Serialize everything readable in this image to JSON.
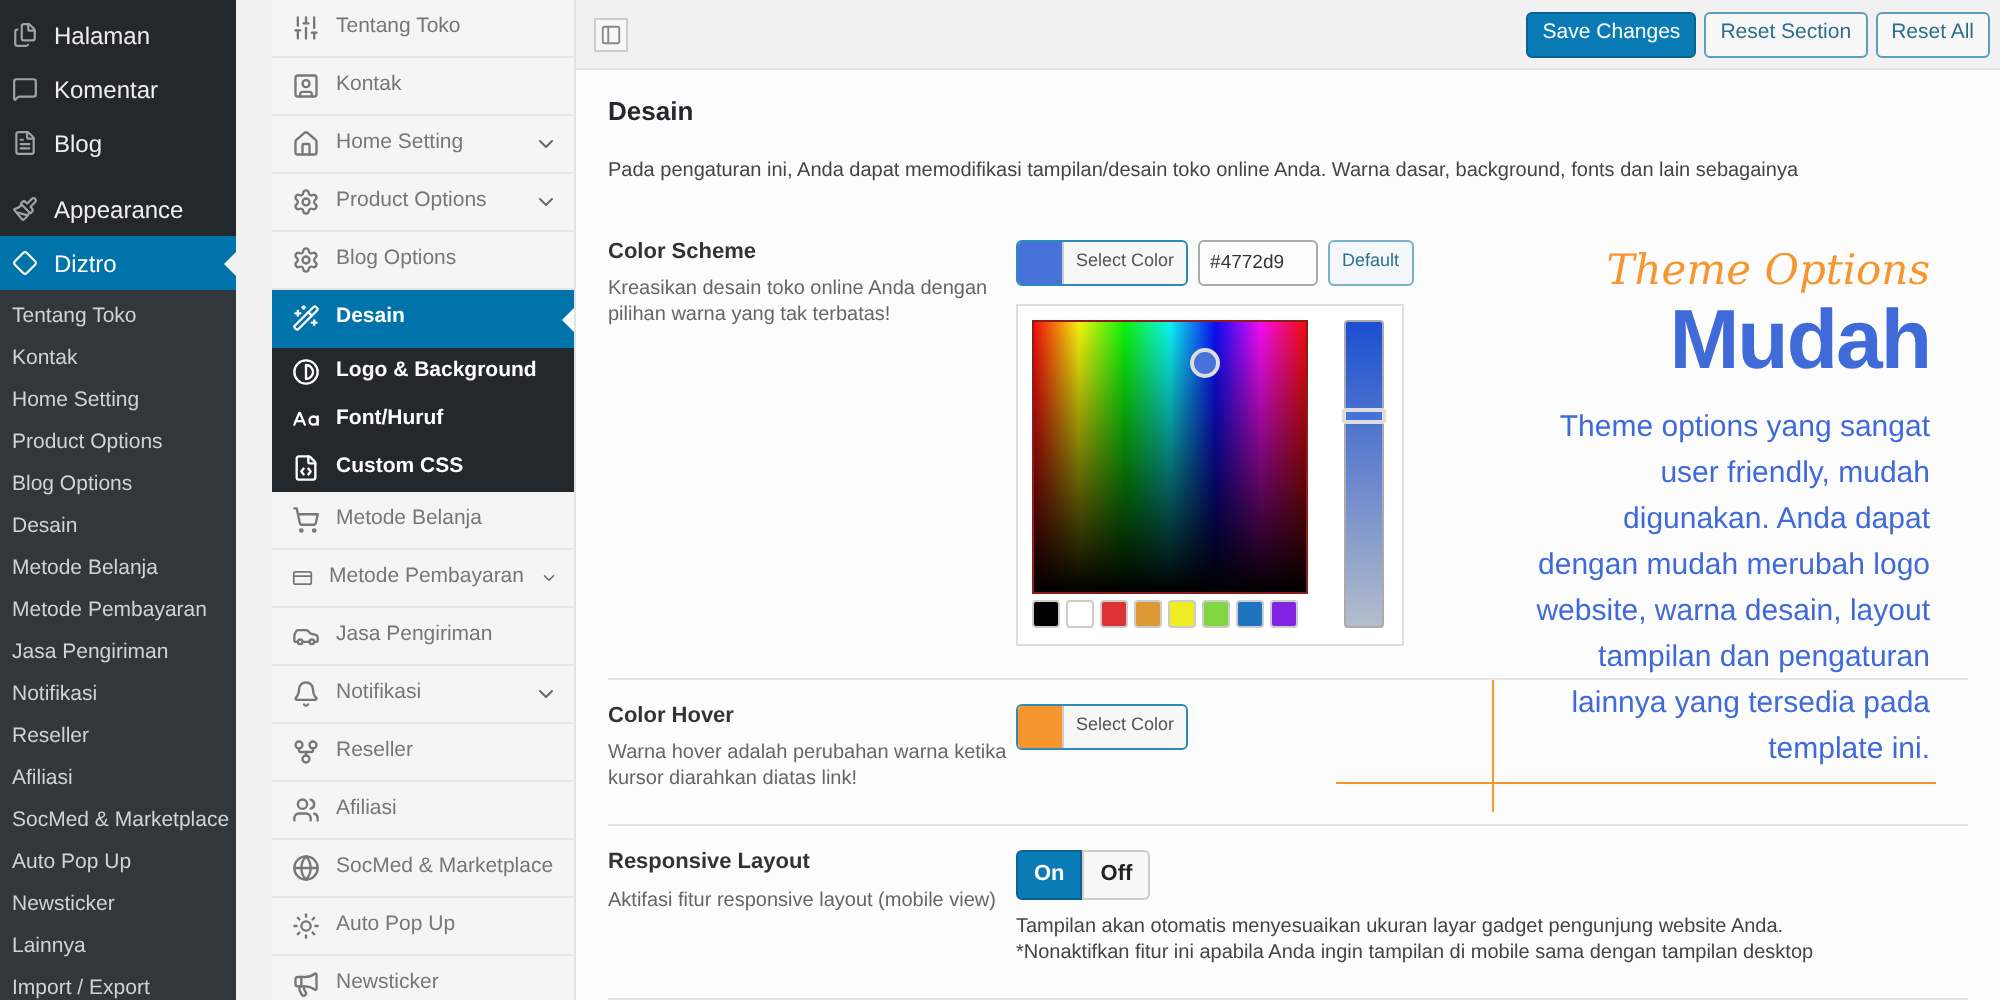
{
  "sidebar": {
    "items": [
      {
        "label": "Halaman",
        "selected": false
      },
      {
        "label": "Komentar",
        "selected": false
      },
      {
        "label": "Blog",
        "selected": false
      },
      {
        "label": "Appearance",
        "selected": false
      },
      {
        "label": "Diztro",
        "selected": true,
        "children": [
          {
            "label": "Tentang Toko",
            "selected": false
          },
          {
            "label": "Kontak",
            "selected": false
          },
          {
            "label": "Home Setting",
            "selected": false
          },
          {
            "label": "Product Options",
            "selected": false
          },
          {
            "label": "Blog Options",
            "selected": false
          },
          {
            "label": "Desain",
            "selected": false
          },
          {
            "label": "Metode Belanja",
            "selected": false
          },
          {
            "label": "Metode Pembayaran",
            "selected": false
          },
          {
            "label": "Jasa Pengiriman",
            "selected": false
          },
          {
            "label": "Notifikasi",
            "selected": false
          },
          {
            "label": "Reseller",
            "selected": false
          },
          {
            "label": "Afiliasi",
            "selected": false
          },
          {
            "label": "SocMed & Marketplace",
            "selected": false
          },
          {
            "label": "Auto Pop Up",
            "selected": false
          },
          {
            "label": "Newsticker",
            "selected": false
          },
          {
            "label": "Lainnya",
            "selected": false
          },
          {
            "label": "Import / Export",
            "selected": false
          }
        ]
      }
    ]
  },
  "options_nav": {
    "items": [
      {
        "label": "Tentang Toko",
        "selected": false,
        "expandable": false
      },
      {
        "label": "Kontak",
        "selected": false,
        "expandable": false
      },
      {
        "label": "Home Setting",
        "selected": false,
        "expandable": true
      },
      {
        "label": "Product Options",
        "selected": false,
        "expandable": true
      },
      {
        "label": "Blog Options",
        "selected": false,
        "expandable": false
      },
      {
        "label": "Desain",
        "selected": true,
        "expandable": false,
        "children": [
          {
            "label": "Logo & Background"
          },
          {
            "label": "Font/Huruf"
          },
          {
            "label": "Custom CSS"
          }
        ]
      },
      {
        "label": "Metode Belanja",
        "selected": false,
        "expandable": false
      },
      {
        "label": "Metode Pembayaran",
        "selected": false,
        "expandable": true
      },
      {
        "label": "Jasa Pengiriman",
        "selected": false,
        "expandable": false
      },
      {
        "label": "Notifikasi",
        "selected": false,
        "expandable": true
      },
      {
        "label": "Reseller",
        "selected": false,
        "expandable": false
      },
      {
        "label": "Afiliasi",
        "selected": false,
        "expandable": false
      },
      {
        "label": "SocMed & Marketplace",
        "selected": false,
        "expandable": false
      },
      {
        "label": "Auto Pop Up",
        "selected": false,
        "expandable": false
      },
      {
        "label": "Newsticker",
        "selected": false,
        "expandable": false
      }
    ]
  },
  "toolbar": {
    "buttons": [
      {
        "label": "Save Changes",
        "kind": "primary"
      },
      {
        "label": "Reset Section",
        "kind": "secondary"
      },
      {
        "label": "Reset All",
        "kind": "secondary"
      }
    ]
  },
  "section": {
    "title": "Desain",
    "description": "Pada pengaturan ini, Anda dapat memodifikasi tampilan/desain toko online Anda. Warna dasar, background, fonts dan lain sebagainya"
  },
  "settings": [
    {
      "kind": "color_picker",
      "title": "Color Scheme",
      "description": "Kreasikan desain toko online Anda dengan pilihan warna yang tak terbatas!",
      "color": "#4772d9",
      "button": "Select Color",
      "value": "#4772d9",
      "default_button": "Default",
      "level": 0.7,
      "palette": [
        {
          "color": "#000000"
        },
        {
          "color": "#ffffff"
        },
        {
          "color": "#dd3333"
        },
        {
          "color": "#dd9933"
        },
        {
          "color": "#eeee22"
        },
        {
          "color": "#81d742"
        },
        {
          "color": "#1e73be"
        },
        {
          "color": "#8224e3"
        }
      ]
    },
    {
      "kind": "color",
      "title": "Color Hover",
      "description": "Warna hover adalah perubahan warna ketika kursor diarahkan diatas link!",
      "color": "#f7962f",
      "button": "Select Color"
    },
    {
      "kind": "toggle",
      "title": "Responsive Layout",
      "description": "Aktifasi fitur responsive layout (mobile view)",
      "options": [
        {
          "label": "On",
          "selected": true
        },
        {
          "label": "Off",
          "selected": false
        }
      ],
      "notes": [
        "Tampilan akan otomatis menyesuaikan ukuran layar gadget pengunjung website Anda.",
        "*Nonaktifkan fitur ini apabila Anda ingin tampilan di mobile sama dengan tampilan desktop"
      ]
    }
  ],
  "promo": {
    "tagline": "Theme Options",
    "headline": "Mudah",
    "text": "Theme options yang sangat user friendly, mudah digunakan. Anda dapat dengan mudah merubah logo website, warna desain, layout tampilan dan pengaturan lainnya yang tersedia pada template ini."
  }
}
